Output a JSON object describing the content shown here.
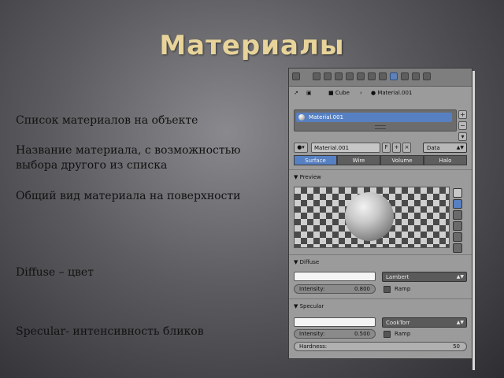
{
  "slide": {
    "title": "Материалы",
    "notes": [
      "Список материалов на объекте",
      "Название материала, с возможностью выбора другого из списка",
      "Общий вид материала на поверхности",
      "Diffuse – цвет",
      "Specular- интенсивность бликов"
    ]
  },
  "panel": {
    "breadcrumb": {
      "object": "Cube",
      "material": "Material.001"
    },
    "material_list": {
      "items": [
        "Material.001"
      ]
    },
    "material_selector": {
      "name": "Material.001",
      "fake_user": "F",
      "link": "Data"
    },
    "tabs": [
      "Surface",
      "Wire",
      "Volume",
      "Halo"
    ],
    "active_tab": "Surface",
    "preview": {
      "header": "Preview"
    },
    "diffuse": {
      "header": "Diffuse",
      "color": "#f4f4f4",
      "shader": "Lambert",
      "intensity_label": "Intensity:",
      "intensity": "0.800",
      "ramp_label": "Ramp"
    },
    "specular": {
      "header": "Specular",
      "color": "#f4f4f4",
      "shader": "CookTorr",
      "intensity_label": "Intensity:",
      "intensity": "0.500",
      "ramp_label": "Ramp",
      "hardness_label": "Hardness:",
      "hardness": "50"
    }
  },
  "colors": {
    "title": "#e8d49a",
    "accent": "#5680c2"
  }
}
